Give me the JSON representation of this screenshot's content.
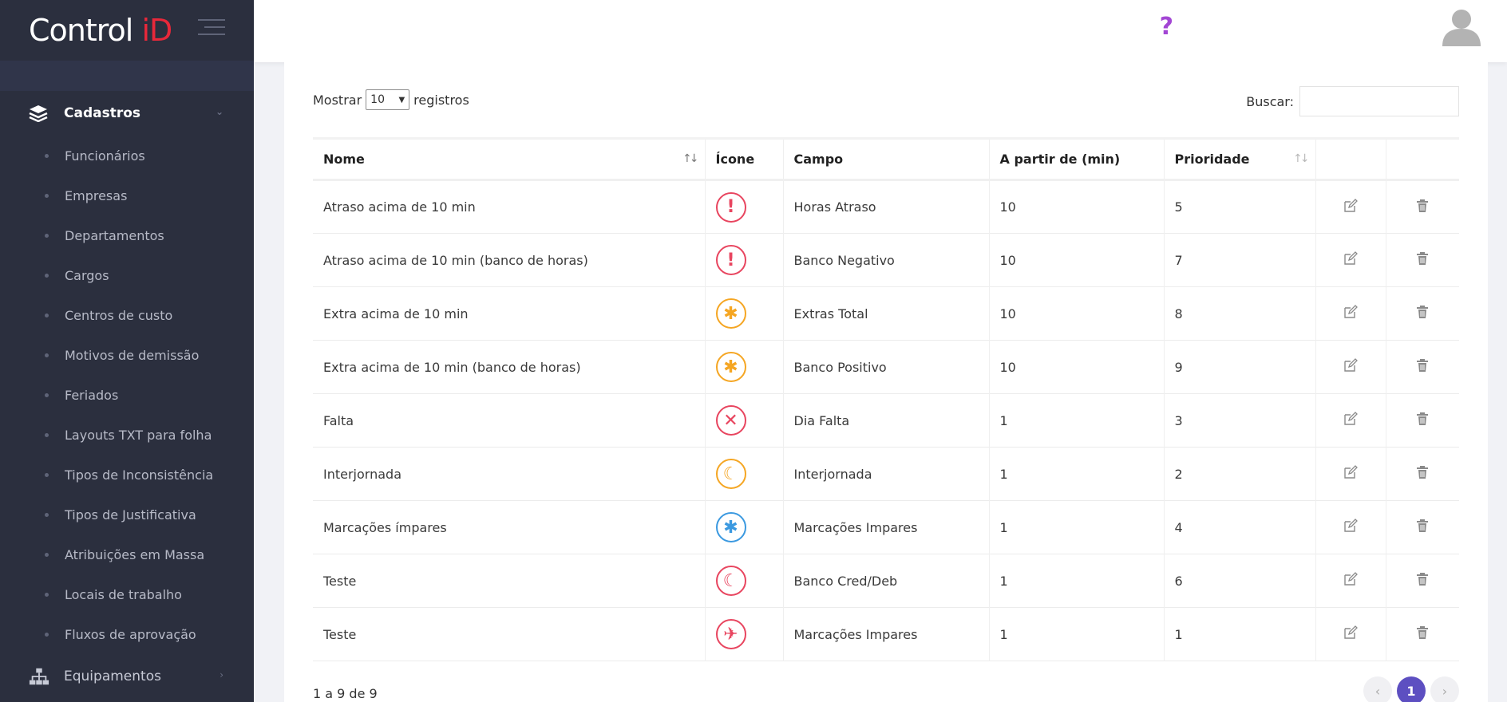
{
  "brand": {
    "logo_main": "Control ",
    "logo_accent": "iD"
  },
  "sidebar": {
    "section": "Cadastros",
    "items": [
      "Funcionários",
      "Empresas",
      "Departamentos",
      "Cargos",
      "Centros de custo",
      "Motivos de demissão",
      "Feriados",
      "Layouts TXT para folha",
      "Tipos de Inconsistência",
      "Tipos de Justificativa",
      "Atribuições em Massa",
      "Locais de trabalho",
      "Fluxos de aprovação"
    ],
    "next_section": "Equipamentos"
  },
  "topbar": {
    "help": "?"
  },
  "controls": {
    "show_label": "Mostrar",
    "page_size": "10",
    "records_label": "registros",
    "search_label": "Buscar:",
    "search_value": ""
  },
  "table": {
    "headers": [
      "Nome",
      "Ícone",
      "Campo",
      "A partir de (min)",
      "Prioridade"
    ],
    "rows": [
      {
        "nome": "Atraso acima de 10 min",
        "icon": "exclamation-icon",
        "glyph": "!",
        "color": "#e8455f",
        "campo": "Horas Atraso",
        "minutos": "10",
        "prioridade": "5"
      },
      {
        "nome": "Atraso acima de 10 min (banco de horas)",
        "icon": "exclamation-icon",
        "glyph": "!",
        "color": "#e8455f",
        "campo": "Banco Negativo",
        "minutos": "10",
        "prioridade": "7"
      },
      {
        "nome": "Extra acima de 10 min",
        "icon": "asterisk-icon",
        "glyph": "✱",
        "color": "#f5a623",
        "campo": "Extras Total",
        "minutos": "10",
        "prioridade": "8"
      },
      {
        "nome": "Extra acima de 10 min (banco de horas)",
        "icon": "asterisk-icon",
        "glyph": "✱",
        "color": "#f5a623",
        "campo": "Banco Positivo",
        "minutos": "10",
        "prioridade": "9"
      },
      {
        "nome": "Falta",
        "icon": "x-icon",
        "glyph": "✕",
        "color": "#e8455f",
        "campo": "Dia Falta",
        "minutos": "1",
        "prioridade": "3"
      },
      {
        "nome": "Interjornada",
        "icon": "moon-icon",
        "glyph": "☾",
        "color": "#f5a623",
        "campo": "Interjornada",
        "minutos": "1",
        "prioridade": "2"
      },
      {
        "nome": "Marcações ímpares",
        "icon": "asterisk-icon",
        "glyph": "✱",
        "color": "#3b99e0",
        "campo": "Marcações Impares",
        "minutos": "1",
        "prioridade": "4"
      },
      {
        "nome": "Teste",
        "icon": "moon-icon",
        "glyph": "☾",
        "color": "#e8455f",
        "campo": "Banco Cred/Deb",
        "minutos": "1",
        "prioridade": "6"
      },
      {
        "nome": "Teste",
        "icon": "plane-icon",
        "glyph": "✈",
        "color": "#e8455f",
        "campo": "Marcações Impares",
        "minutos": "1",
        "prioridade": "1"
      }
    ]
  },
  "footer": {
    "info": "1 a 9 de 9",
    "current_page": "1"
  }
}
